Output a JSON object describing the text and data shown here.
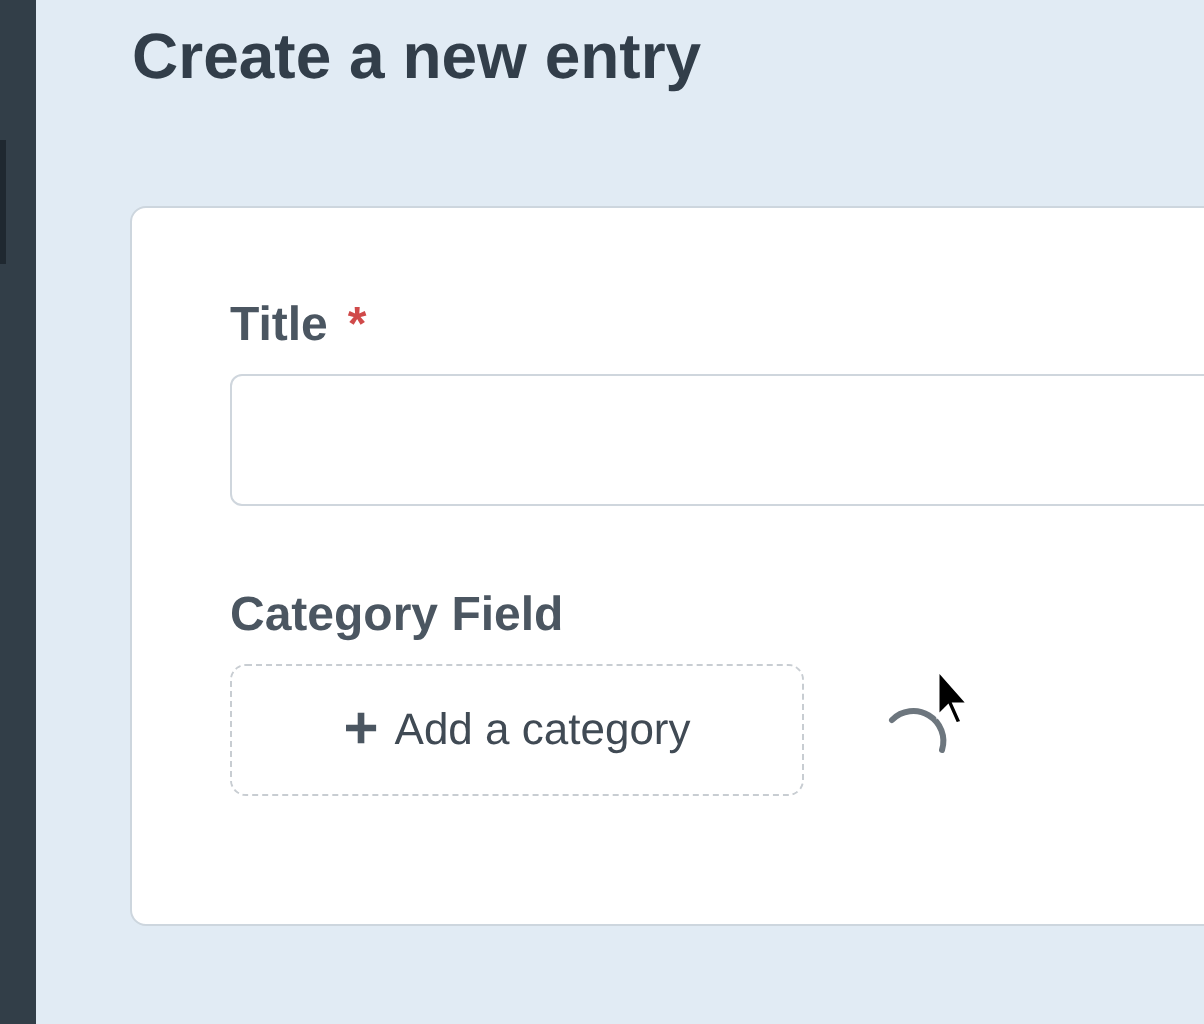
{
  "page": {
    "title": "Create a new entry"
  },
  "fields": [
    {
      "kind": "text",
      "label": "Title",
      "required_mark": "*"
    },
    {
      "kind": "category",
      "label": "Category Field",
      "button": {
        "icon": "+",
        "label": "Add a category"
      },
      "loading": true
    }
  ]
}
